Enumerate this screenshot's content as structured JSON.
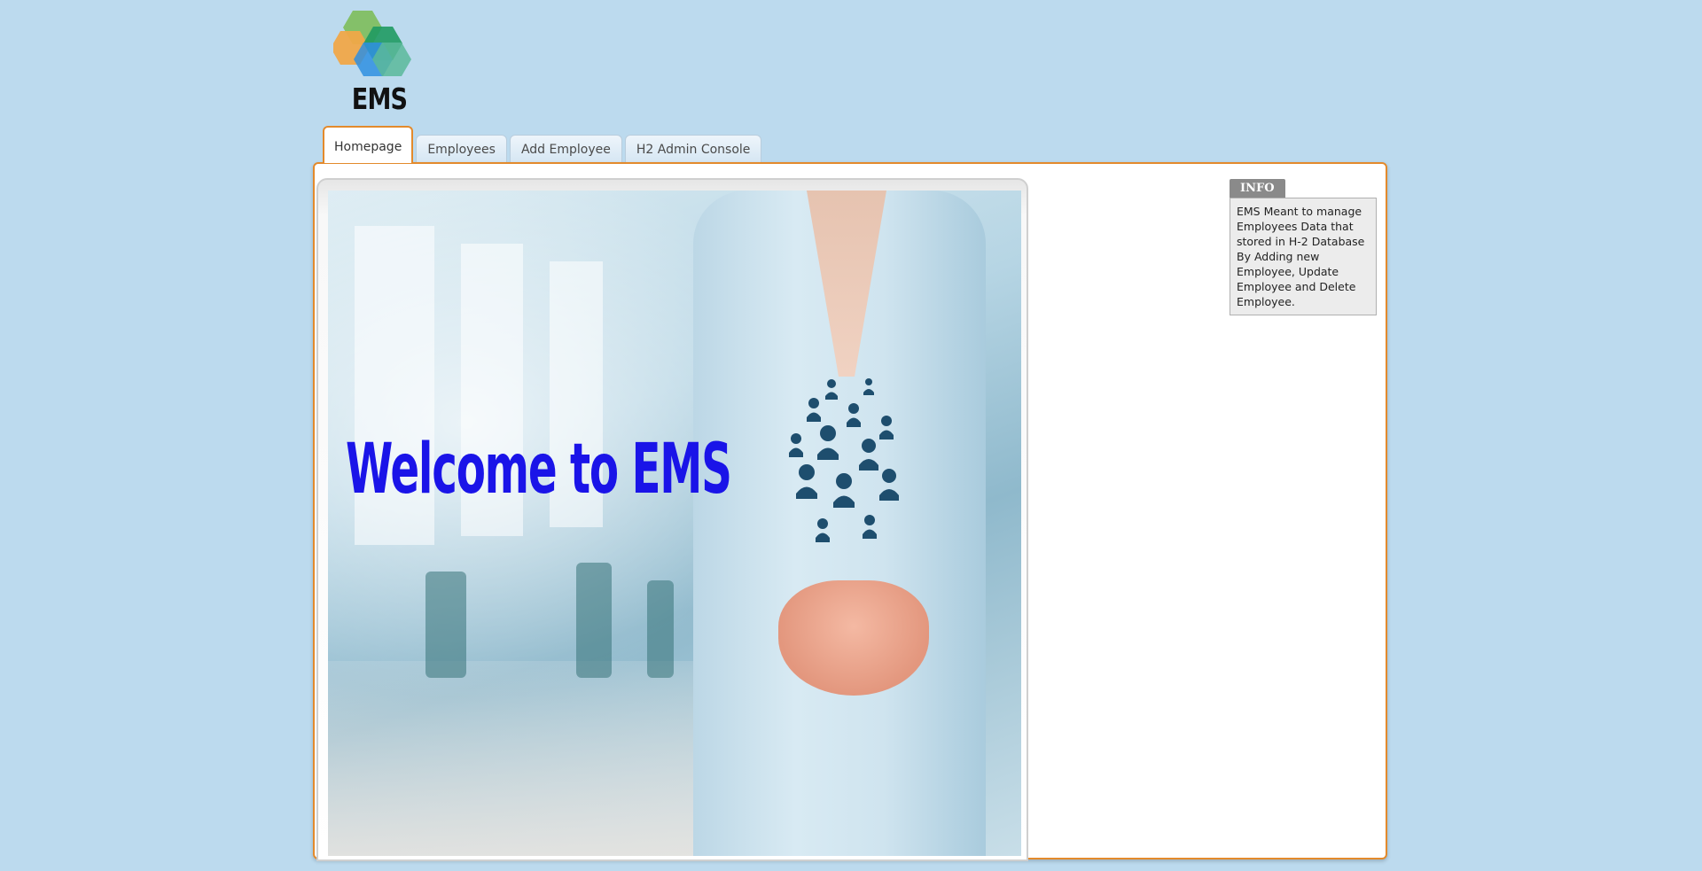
{
  "logo": {
    "text": "EMS",
    "icon": "hexagon-cluster-logo"
  },
  "tabs": [
    {
      "label": "Homepage",
      "active": true
    },
    {
      "label": "Employees",
      "active": false
    },
    {
      "label": "Add Employee",
      "active": false
    },
    {
      "label": "H2 Admin Console",
      "active": false
    }
  ],
  "hero": {
    "headline": "Welcome to EMS"
  },
  "info": {
    "title": "INFO",
    "body": "EMS Meant to manage Employees Data that stored in H-2 Database By Adding new Employee, Update Employee and Delete Employee."
  },
  "colors": {
    "page_background": "#bcdaee",
    "accent": "#e38a2c",
    "headline": "#1a14e8",
    "info_header": "#8a8a8a"
  }
}
